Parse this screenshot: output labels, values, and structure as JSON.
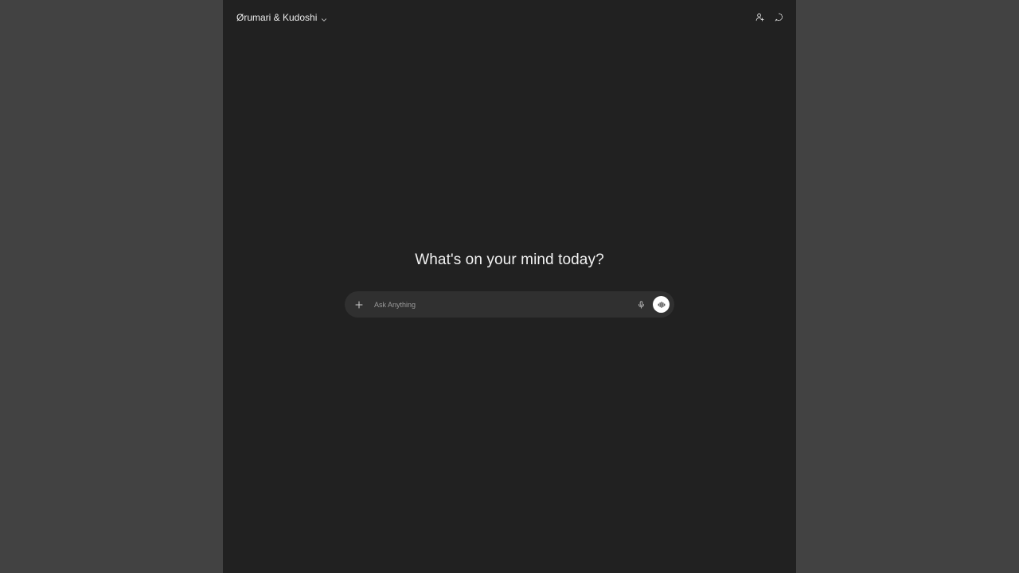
{
  "header": {
    "model_label": "Ørumari & Kudoshi",
    "model_chevron_icon": "chevron-down-icon",
    "user_icon": "user-add-icon",
    "chat_icon": "temporary-chat-icon"
  },
  "main": {
    "headline": "What's on your mind today?"
  },
  "composer": {
    "placeholder": "Ask Anything",
    "value": "",
    "attach_icon": "plus-icon",
    "mic_icon": "microphone-icon",
    "voice_icon": "voice-waveform-icon"
  },
  "colors": {
    "page_background": "#424242",
    "app_background": "#212121",
    "composer_background": "#303030",
    "text": "#ececec",
    "voice_button": "#ffffff"
  }
}
